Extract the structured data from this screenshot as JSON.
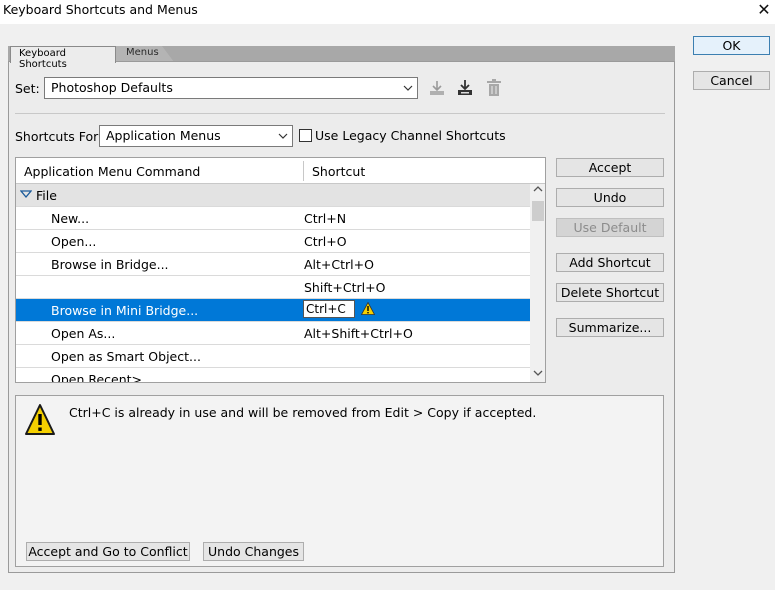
{
  "window": {
    "title": "Keyboard Shortcuts and Menus",
    "close_glyph": "✕"
  },
  "tabs": [
    {
      "label": "Keyboard Shortcuts"
    },
    {
      "label": "Menus"
    }
  ],
  "set": {
    "label": "Set:",
    "value": "Photoshop Defaults"
  },
  "shortcuts_for": {
    "label": "Shortcuts For:",
    "value": "Application Menus",
    "legacy_checkbox_label": "Use Legacy Channel Shortcuts",
    "legacy_checked": false
  },
  "table": {
    "col_command": "Application Menu Command",
    "col_shortcut": "Shortcut",
    "rows": [
      {
        "command": "File",
        "shortcut": "",
        "group": true
      },
      {
        "command": "New...",
        "shortcut": "Ctrl+N"
      },
      {
        "command": "Open...",
        "shortcut": "Ctrl+O"
      },
      {
        "command": "Browse in Bridge...",
        "shortcut": "Alt+Ctrl+O"
      },
      {
        "command": "",
        "shortcut": "Shift+Ctrl+O"
      },
      {
        "command": "Browse in Mini Bridge...",
        "shortcut": "Ctrl+C",
        "selected": true
      },
      {
        "command": "Open As...",
        "shortcut": "Alt+Shift+Ctrl+O"
      },
      {
        "command": "Open as Smart Object...",
        "shortcut": ""
      },
      {
        "command": "Open Recent>",
        "shortcut": ""
      }
    ]
  },
  "side_buttons": {
    "accept": "Accept",
    "undo": "Undo",
    "use_default": "Use Default",
    "add_shortcut": "Add Shortcut",
    "delete_shortcut": "Delete Shortcut",
    "summarize": "Summarize..."
  },
  "dialog_buttons": {
    "ok": "OK",
    "cancel": "Cancel"
  },
  "message": {
    "text": "Ctrl+C is already in use and will be removed from Edit > Copy if accepted.",
    "accept_go": "Accept and Go to Conflict",
    "undo_changes": "Undo Changes"
  },
  "colors": {
    "selection": "#0078d7",
    "warning": "#f5d000"
  }
}
